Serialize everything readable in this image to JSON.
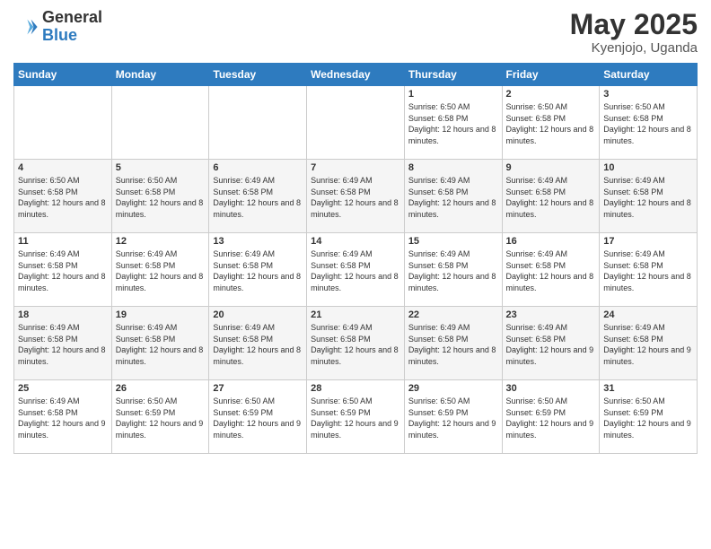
{
  "logo": {
    "general": "General",
    "blue": "Blue"
  },
  "title": {
    "main": "May 2025",
    "sub": "Kyenjojo, Uganda"
  },
  "days_header": [
    "Sunday",
    "Monday",
    "Tuesday",
    "Wednesday",
    "Thursday",
    "Friday",
    "Saturday"
  ],
  "weeks": [
    [
      {
        "day": "",
        "info": ""
      },
      {
        "day": "",
        "info": ""
      },
      {
        "day": "",
        "info": ""
      },
      {
        "day": "",
        "info": ""
      },
      {
        "day": "1",
        "info": "Sunrise: 6:50 AM\nSunset: 6:58 PM\nDaylight: 12 hours and 8 minutes."
      },
      {
        "day": "2",
        "info": "Sunrise: 6:50 AM\nSunset: 6:58 PM\nDaylight: 12 hours and 8 minutes."
      },
      {
        "day": "3",
        "info": "Sunrise: 6:50 AM\nSunset: 6:58 PM\nDaylight: 12 hours and 8 minutes."
      }
    ],
    [
      {
        "day": "4",
        "info": "Sunrise: 6:50 AM\nSunset: 6:58 PM\nDaylight: 12 hours and 8 minutes."
      },
      {
        "day": "5",
        "info": "Sunrise: 6:50 AM\nSunset: 6:58 PM\nDaylight: 12 hours and 8 minutes."
      },
      {
        "day": "6",
        "info": "Sunrise: 6:49 AM\nSunset: 6:58 PM\nDaylight: 12 hours and 8 minutes."
      },
      {
        "day": "7",
        "info": "Sunrise: 6:49 AM\nSunset: 6:58 PM\nDaylight: 12 hours and 8 minutes."
      },
      {
        "day": "8",
        "info": "Sunrise: 6:49 AM\nSunset: 6:58 PM\nDaylight: 12 hours and 8 minutes."
      },
      {
        "day": "9",
        "info": "Sunrise: 6:49 AM\nSunset: 6:58 PM\nDaylight: 12 hours and 8 minutes."
      },
      {
        "day": "10",
        "info": "Sunrise: 6:49 AM\nSunset: 6:58 PM\nDaylight: 12 hours and 8 minutes."
      }
    ],
    [
      {
        "day": "11",
        "info": "Sunrise: 6:49 AM\nSunset: 6:58 PM\nDaylight: 12 hours and 8 minutes."
      },
      {
        "day": "12",
        "info": "Sunrise: 6:49 AM\nSunset: 6:58 PM\nDaylight: 12 hours and 8 minutes."
      },
      {
        "day": "13",
        "info": "Sunrise: 6:49 AM\nSunset: 6:58 PM\nDaylight: 12 hours and 8 minutes."
      },
      {
        "day": "14",
        "info": "Sunrise: 6:49 AM\nSunset: 6:58 PM\nDaylight: 12 hours and 8 minutes."
      },
      {
        "day": "15",
        "info": "Sunrise: 6:49 AM\nSunset: 6:58 PM\nDaylight: 12 hours and 8 minutes."
      },
      {
        "day": "16",
        "info": "Sunrise: 6:49 AM\nSunset: 6:58 PM\nDaylight: 12 hours and 8 minutes."
      },
      {
        "day": "17",
        "info": "Sunrise: 6:49 AM\nSunset: 6:58 PM\nDaylight: 12 hours and 8 minutes."
      }
    ],
    [
      {
        "day": "18",
        "info": "Sunrise: 6:49 AM\nSunset: 6:58 PM\nDaylight: 12 hours and 8 minutes."
      },
      {
        "day": "19",
        "info": "Sunrise: 6:49 AM\nSunset: 6:58 PM\nDaylight: 12 hours and 8 minutes."
      },
      {
        "day": "20",
        "info": "Sunrise: 6:49 AM\nSunset: 6:58 PM\nDaylight: 12 hours and 8 minutes."
      },
      {
        "day": "21",
        "info": "Sunrise: 6:49 AM\nSunset: 6:58 PM\nDaylight: 12 hours and 8 minutes."
      },
      {
        "day": "22",
        "info": "Sunrise: 6:49 AM\nSunset: 6:58 PM\nDaylight: 12 hours and 8 minutes."
      },
      {
        "day": "23",
        "info": "Sunrise: 6:49 AM\nSunset: 6:58 PM\nDaylight: 12 hours and 9 minutes."
      },
      {
        "day": "24",
        "info": "Sunrise: 6:49 AM\nSunset: 6:58 PM\nDaylight: 12 hours and 9 minutes."
      }
    ],
    [
      {
        "day": "25",
        "info": "Sunrise: 6:49 AM\nSunset: 6:58 PM\nDaylight: 12 hours and 9 minutes."
      },
      {
        "day": "26",
        "info": "Sunrise: 6:50 AM\nSunset: 6:59 PM\nDaylight: 12 hours and 9 minutes."
      },
      {
        "day": "27",
        "info": "Sunrise: 6:50 AM\nSunset: 6:59 PM\nDaylight: 12 hours and 9 minutes."
      },
      {
        "day": "28",
        "info": "Sunrise: 6:50 AM\nSunset: 6:59 PM\nDaylight: 12 hours and 9 minutes."
      },
      {
        "day": "29",
        "info": "Sunrise: 6:50 AM\nSunset: 6:59 PM\nDaylight: 12 hours and 9 minutes."
      },
      {
        "day": "30",
        "info": "Sunrise: 6:50 AM\nSunset: 6:59 PM\nDaylight: 12 hours and 9 minutes."
      },
      {
        "day": "31",
        "info": "Sunrise: 6:50 AM\nSunset: 6:59 PM\nDaylight: 12 hours and 9 minutes."
      }
    ]
  ]
}
